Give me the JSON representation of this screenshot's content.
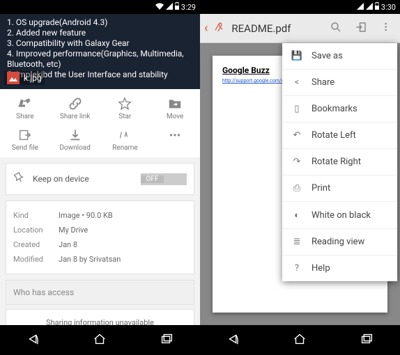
{
  "left": {
    "time": "3:29",
    "preview_lines": [
      "OS upgrade(Android 4.3)",
      "Added new feature",
      "Compatibility with Galaxy Gear",
      "Improved performance(Graphics, Multimedia, Bluetooth, etc)",
      "Implekjbd the User Interface and stability"
    ],
    "filename": "k.jpg",
    "actions_row1": [
      {
        "id": "share",
        "label": "Share"
      },
      {
        "id": "share-link",
        "label": "Share link"
      },
      {
        "id": "star",
        "label": "Star"
      },
      {
        "id": "move",
        "label": "Move"
      }
    ],
    "actions_row2": [
      {
        "id": "send-file",
        "label": "Send file"
      },
      {
        "id": "download",
        "label": "Download"
      },
      {
        "id": "rename",
        "label": "Rename"
      },
      {
        "id": "more",
        "label": ""
      }
    ],
    "keep_on_device": "Keep on device",
    "toggle_state": "OFF",
    "details": {
      "kind_label": "Kind",
      "kind_value": "Image   •  90.0 KB",
      "location_label": "Location",
      "location_value": "My Drive",
      "created_label": "Created",
      "created_value": "Jan 8",
      "modified_label": "Modified",
      "modified_value": "Jan 8 by Srivatsan"
    },
    "who_has_access": "Who has access",
    "sharing_info": "Sharing information unavailable"
  },
  "right": {
    "time": "3:30",
    "title": "README.pdf",
    "page_heading": "Google Buzz",
    "page_link": "http://support.google.com/drive/?p=el",
    "menu": [
      {
        "id": "save-as",
        "label": "Save as",
        "icon": "💾"
      },
      {
        "id": "share",
        "label": "Share",
        "icon": "<"
      },
      {
        "id": "bookmarks",
        "label": "Bookmarks",
        "icon": "▯"
      },
      {
        "id": "rotate-left",
        "label": "Rotate Left",
        "icon": "↶"
      },
      {
        "id": "rotate-right",
        "label": "Rotate Right",
        "icon": "↷"
      },
      {
        "id": "print",
        "label": "Print",
        "icon": "⎙"
      },
      {
        "id": "white-on-black",
        "label": "White on black",
        "icon": "◐"
      },
      {
        "id": "reading-view",
        "label": "Reading view",
        "icon": "≣"
      },
      {
        "id": "help",
        "label": "Help",
        "icon": "?"
      }
    ]
  }
}
